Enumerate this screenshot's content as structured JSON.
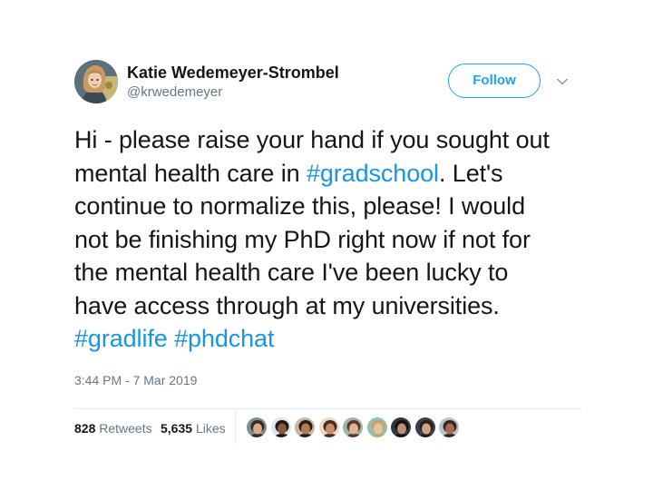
{
  "author": {
    "display_name": "Katie Wedemeyer-Strombel",
    "handle": "@krwedemeyer"
  },
  "follow_label": "Follow",
  "tweet_lines": [
    [
      {
        "t": "Hi - please raise your hand if you sought out",
        "tag": false
      }
    ],
    [
      {
        "t": "mental health care in ",
        "tag": false
      },
      {
        "t": "#gradschool",
        "tag": true
      },
      {
        "t": ". Let's",
        "tag": false
      }
    ],
    [
      {
        "t": "continue to normalize this, please! I would",
        "tag": false
      }
    ],
    [
      {
        "t": "not be finishing my PhD right now if not for",
        "tag": false
      }
    ],
    [
      {
        "t": "the mental health care I've been lucky to",
        "tag": false
      }
    ],
    [
      {
        "t": "have access through at my universities.",
        "tag": false
      }
    ],
    [
      {
        "t": "#gradlife",
        "tag": true
      },
      {
        "t": " ",
        "tag": false
      },
      {
        "t": "#phdchat",
        "tag": true
      }
    ]
  ],
  "timestamp": "3:44 PM - 7 Mar 2019",
  "stats": {
    "retweets_count": "828",
    "retweets_label": "Retweets",
    "likes_count": "5,635",
    "likes_label": "Likes"
  },
  "colors": {
    "accent": "#1da1f2",
    "hashtag": "#1b95e0",
    "muted": "#657786"
  },
  "liker_faces": [
    {
      "bg": "#7a8f98",
      "skin": "#d9a98a",
      "hair": "#3b2a1e"
    },
    {
      "bg": "#dfe6ea",
      "skin": "#8a5a3c",
      "hair": "#1e1612"
    },
    {
      "bg": "#c8b79f",
      "skin": "#b07a55",
      "hair": "#2b1d14"
    },
    {
      "bg": "#e9d9c7",
      "skin": "#c98d6a",
      "hair": "#4a2c1a"
    },
    {
      "bg": "#9fb6a4",
      "skin": "#e0b496",
      "hair": "#5a3a24"
    },
    {
      "bg": "#8fc3a8",
      "skin": "#e7c2a3",
      "hair": "#c9a06a"
    },
    {
      "bg": "#2f3a3e",
      "skin": "#c08f70",
      "hair": "#141414"
    },
    {
      "bg": "#3a3f52",
      "skin": "#d2a080",
      "hair": "#2a1e18"
    },
    {
      "bg": "#b7c4c9",
      "skin": "#a46b4c",
      "hair": "#3a2418"
    }
  ]
}
